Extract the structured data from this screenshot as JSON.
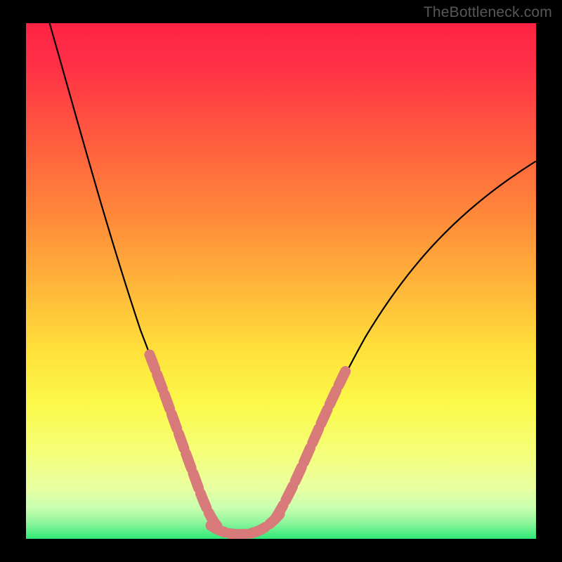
{
  "watermark": "TheBottleneck.com",
  "chart_data": {
    "type": "line",
    "title": "",
    "xlabel": "",
    "ylabel": "",
    "xlim": [
      0,
      100
    ],
    "ylim": [
      0,
      100
    ],
    "grid": false,
    "legend": false,
    "background_gradient": {
      "top_color": "#ff2745",
      "mid_colors": [
        "#ff8a3a",
        "#ffe23a",
        "#f9ff66"
      ],
      "bottom_color": "#2fe877"
    },
    "series": [
      {
        "name": "bottleneck-curve",
        "color": "#000000",
        "x": [
          5,
          8,
          12,
          16,
          20,
          24,
          27,
          30,
          33,
          36,
          38,
          40,
          42,
          44,
          46,
          50,
          54,
          58,
          62,
          66,
          70,
          74,
          78,
          82,
          86,
          90,
          94,
          98
        ],
        "y": [
          100,
          90,
          78,
          67,
          56,
          45,
          37,
          29,
          22,
          15,
          10,
          6,
          3,
          1,
          1,
          3,
          8,
          15,
          22,
          29,
          36,
          42,
          48,
          54,
          59,
          64,
          68,
          72
        ]
      },
      {
        "name": "highlight-left-segment",
        "color": "#d87a7a",
        "style": "dashed-thick",
        "x": [
          24,
          27,
          30,
          33,
          36,
          38,
          40
        ],
        "y": [
          40,
          33,
          26,
          19,
          13,
          8,
          4
        ]
      },
      {
        "name": "highlight-bottom-segment",
        "color": "#d87a7a",
        "style": "dashed-thick",
        "x": [
          40,
          42,
          44,
          46,
          48,
          50
        ],
        "y": [
          4,
          2,
          1,
          1,
          2,
          3
        ]
      },
      {
        "name": "highlight-right-segment",
        "color": "#d87a7a",
        "style": "dashed-thick",
        "x": [
          50,
          53,
          56,
          59,
          62
        ],
        "y": [
          3,
          7,
          12,
          18,
          24
        ]
      }
    ],
    "annotations": []
  }
}
